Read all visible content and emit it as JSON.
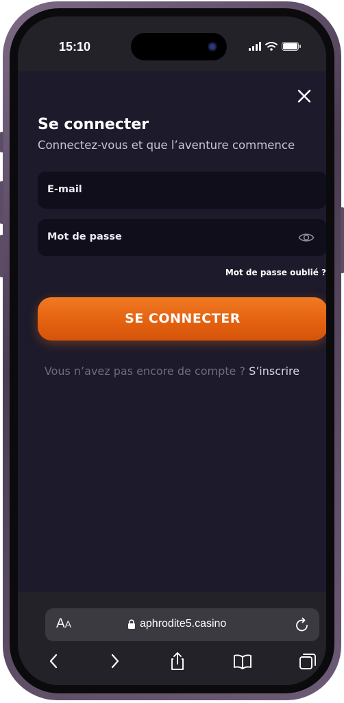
{
  "status_bar": {
    "time": "15:10",
    "icons": [
      "signal-icon",
      "wifi-icon",
      "battery-icon"
    ]
  },
  "modal": {
    "title": "Se connecter",
    "subtitle": "Connectez-vous et que l’aventure commence",
    "email_field": {
      "label": "E-mail",
      "value": ""
    },
    "password_field": {
      "label": "Mot de passe",
      "value": "",
      "toggle_icon": "eye-icon"
    },
    "forgot_password": "Mot de passe oublié ?",
    "submit_label": "SE CONNECTER",
    "signup_prompt": "Vous n’avez pas encore de compte ?",
    "signup_link": "S’inscrire",
    "close_icon": "close-icon"
  },
  "browser": {
    "text_size_label_big": "A",
    "text_size_label_small": "A",
    "url": "aphrodite5.casino",
    "nav_icons": [
      "back-icon",
      "forward-icon",
      "share-icon",
      "bookmarks-icon",
      "tabs-icon"
    ]
  },
  "colors": {
    "background": "#1c1a2b",
    "field_background": "#0f0e1a",
    "accent": "#e86a17",
    "muted_text": "#6f6c7e",
    "browser_bar": "#242229"
  }
}
